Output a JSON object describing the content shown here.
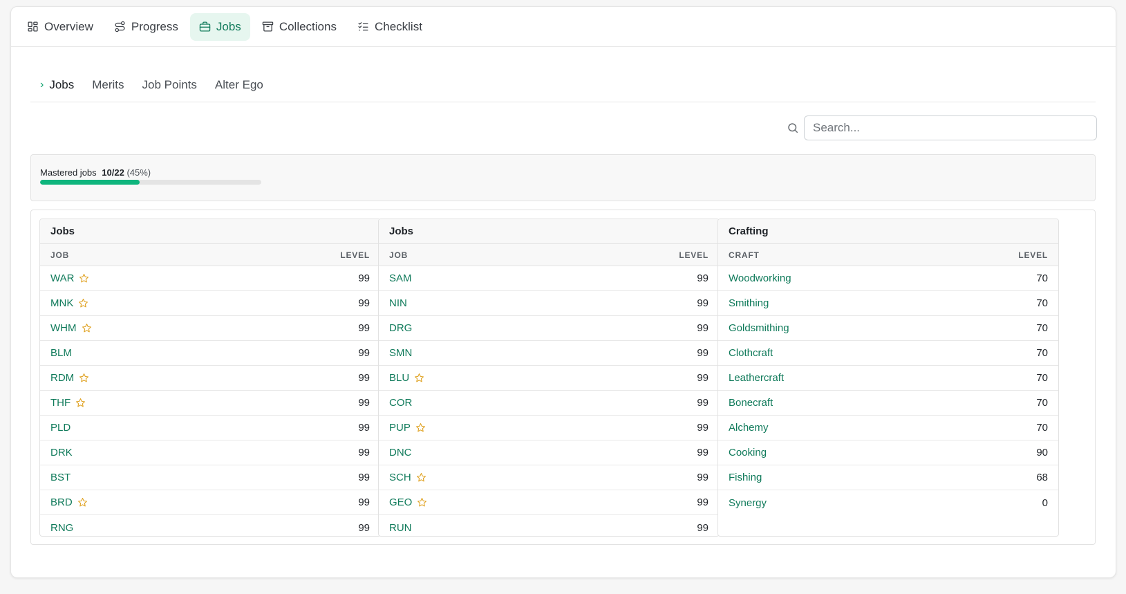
{
  "topnav": {
    "tabs": [
      {
        "label": "Overview",
        "icon": "grid-icon",
        "active": false
      },
      {
        "label": "Progress",
        "icon": "route-icon",
        "active": false
      },
      {
        "label": "Jobs",
        "icon": "briefcase-icon",
        "active": true
      },
      {
        "label": "Collections",
        "icon": "archive-icon",
        "active": false
      },
      {
        "label": "Checklist",
        "icon": "list-checks-icon",
        "active": false
      }
    ]
  },
  "subnav": {
    "tabs": [
      {
        "label": "Jobs",
        "active": true
      },
      {
        "label": "Merits",
        "active": false
      },
      {
        "label": "Job Points",
        "active": false
      },
      {
        "label": "Alter Ego",
        "active": false
      }
    ]
  },
  "search": {
    "placeholder": "Search...",
    "value": ""
  },
  "mastery": {
    "label": "Mastered jobs",
    "count": "10/22",
    "percent_text": "(45%)",
    "fraction": 0.45
  },
  "colors": {
    "accent": "#0f7a5a",
    "progress": "#0fb57d",
    "star": "#e0a324"
  },
  "panels": [
    {
      "title": "Jobs",
      "col_name": "JOB",
      "col_level": "LEVEL",
      "rows": [
        {
          "name": "WAR",
          "level": "99",
          "mastered": true
        },
        {
          "name": "MNK",
          "level": "99",
          "mastered": true
        },
        {
          "name": "WHM",
          "level": "99",
          "mastered": true
        },
        {
          "name": "BLM",
          "level": "99",
          "mastered": false
        },
        {
          "name": "RDM",
          "level": "99",
          "mastered": true
        },
        {
          "name": "THF",
          "level": "99",
          "mastered": true
        },
        {
          "name": "PLD",
          "level": "99",
          "mastered": false
        },
        {
          "name": "DRK",
          "level": "99",
          "mastered": false
        },
        {
          "name": "BST",
          "level": "99",
          "mastered": false
        },
        {
          "name": "BRD",
          "level": "99",
          "mastered": true
        },
        {
          "name": "RNG",
          "level": "99",
          "mastered": false
        }
      ]
    },
    {
      "title": "Jobs",
      "col_name": "JOB",
      "col_level": "LEVEL",
      "rows": [
        {
          "name": "SAM",
          "level": "99",
          "mastered": false
        },
        {
          "name": "NIN",
          "level": "99",
          "mastered": false
        },
        {
          "name": "DRG",
          "level": "99",
          "mastered": false
        },
        {
          "name": "SMN",
          "level": "99",
          "mastered": false
        },
        {
          "name": "BLU",
          "level": "99",
          "mastered": true
        },
        {
          "name": "COR",
          "level": "99",
          "mastered": false
        },
        {
          "name": "PUP",
          "level": "99",
          "mastered": true
        },
        {
          "name": "DNC",
          "level": "99",
          "mastered": false
        },
        {
          "name": "SCH",
          "level": "99",
          "mastered": true
        },
        {
          "name": "GEO",
          "level": "99",
          "mastered": true
        },
        {
          "name": "RUN",
          "level": "99",
          "mastered": false
        }
      ]
    },
    {
      "title": "Crafting",
      "col_name": "CRAFT",
      "col_level": "LEVEL",
      "rows": [
        {
          "name": "Woodworking",
          "level": "70",
          "mastered": false
        },
        {
          "name": "Smithing",
          "level": "70",
          "mastered": false
        },
        {
          "name": "Goldsmithing",
          "level": "70",
          "mastered": false
        },
        {
          "name": "Clothcraft",
          "level": "70",
          "mastered": false
        },
        {
          "name": "Leathercraft",
          "level": "70",
          "mastered": false
        },
        {
          "name": "Bonecraft",
          "level": "70",
          "mastered": false
        },
        {
          "name": "Alchemy",
          "level": "70",
          "mastered": false
        },
        {
          "name": "Cooking",
          "level": "90",
          "mastered": false
        },
        {
          "name": "Fishing",
          "level": "68",
          "mastered": false
        },
        {
          "name": "Synergy",
          "level": "0",
          "mastered": false
        }
      ]
    }
  ]
}
